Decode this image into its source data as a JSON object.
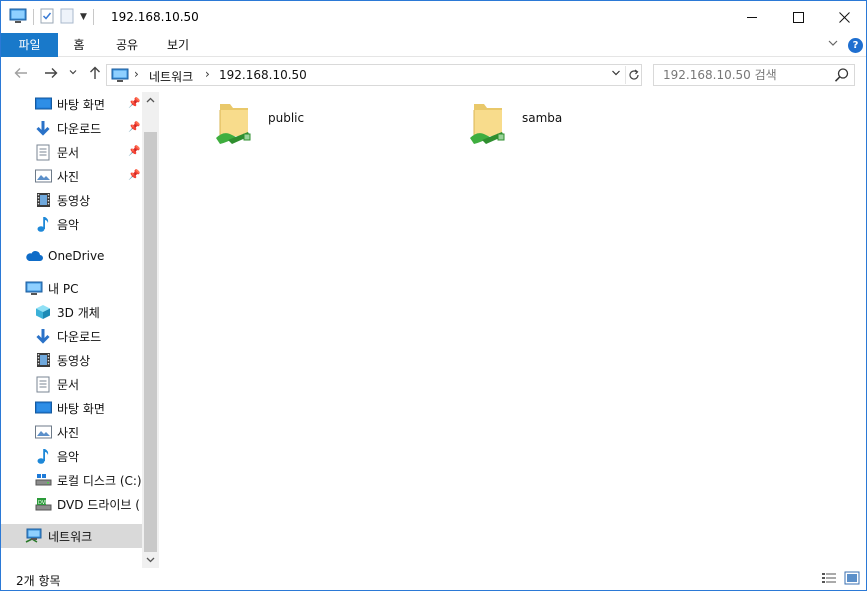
{
  "window": {
    "title": "192.168.10.50"
  },
  "ribbon": {
    "tabs": [
      {
        "label": "파일",
        "active": true
      },
      {
        "label": "홈",
        "active": false
      },
      {
        "label": "공유",
        "active": false
      },
      {
        "label": "보기",
        "active": false
      }
    ]
  },
  "address": {
    "crumbs": [
      "네트워크",
      "192.168.10.50"
    ]
  },
  "search": {
    "placeholder": "192.168.10.50 검색"
  },
  "navpane": {
    "quick_access": [
      {
        "label": "바탕 화면",
        "icon": "desktop-icon",
        "pinned": true
      },
      {
        "label": "다운로드",
        "icon": "download-icon",
        "pinned": true
      },
      {
        "label": "문서",
        "icon": "document-icon",
        "pinned": true
      },
      {
        "label": "사진",
        "icon": "pictures-icon",
        "pinned": true
      },
      {
        "label": "동영상",
        "icon": "video-icon",
        "pinned": false
      },
      {
        "label": "음악",
        "icon": "music-icon",
        "pinned": false
      }
    ],
    "onedrive": {
      "label": "OneDrive",
      "icon": "cloud-icon"
    },
    "this_pc": {
      "label": "내 PC",
      "icon": "pc-icon"
    },
    "pc_items": [
      {
        "label": "3D 개체",
        "icon": "cube-icon"
      },
      {
        "label": "다운로드",
        "icon": "download-icon"
      },
      {
        "label": "동영상",
        "icon": "video-icon"
      },
      {
        "label": "문서",
        "icon": "document-icon"
      },
      {
        "label": "바탕 화면",
        "icon": "desktop-icon"
      },
      {
        "label": "사진",
        "icon": "pictures-icon"
      },
      {
        "label": "음악",
        "icon": "music-icon"
      },
      {
        "label": "로컬 디스크 (C:)",
        "icon": "drive-icon"
      },
      {
        "label": "DVD 드라이브 (",
        "icon": "dvd-icon"
      }
    ],
    "network": {
      "label": "네트워크",
      "icon": "network-icon",
      "selected": true
    }
  },
  "content": {
    "items": [
      {
        "label": "public",
        "icon": "shared-folder-icon"
      },
      {
        "label": "samba",
        "icon": "shared-folder-icon"
      }
    ]
  },
  "status": {
    "count": "2개 항목"
  },
  "colors": {
    "accent": "#1979ca",
    "border": "#2b79d6",
    "selection": "#d9d9d9"
  }
}
